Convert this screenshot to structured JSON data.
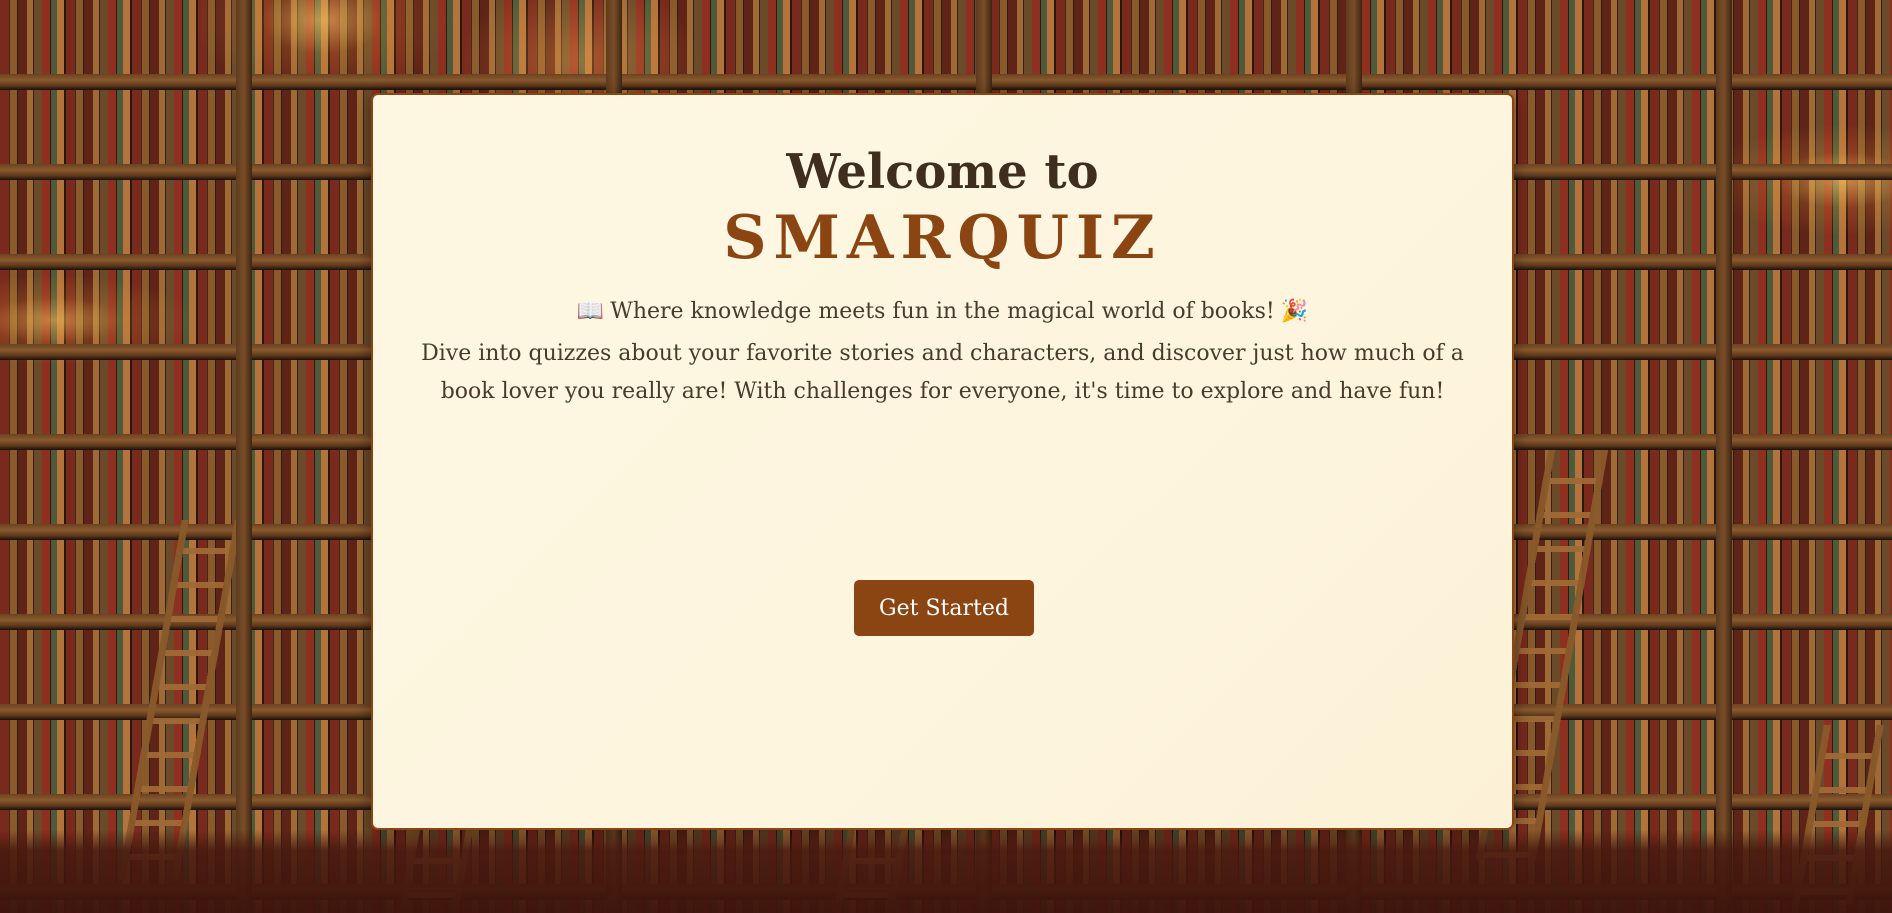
{
  "card": {
    "welcome_line": "Welcome to",
    "brand": "SMARQUIZ",
    "tagline": "Where knowledge meets fun in the magical world of books!",
    "tagline_icon_left": "📖",
    "tagline_icon_right": "🎉",
    "description": "Dive into quizzes about your favorite stories and characters, and discover just how much of a book lover you really are! With challenges for everyone, it's time to explore and have fun!",
    "button_label": "Get Started"
  },
  "colors": {
    "accent": "#8b4513",
    "card_background": "#fdf6e1",
    "heading_text": "#3f2d1e",
    "body_text": "#4a3a2c"
  },
  "icons": {
    "left": "open-book-icon",
    "right": "party-popper-icon"
  }
}
